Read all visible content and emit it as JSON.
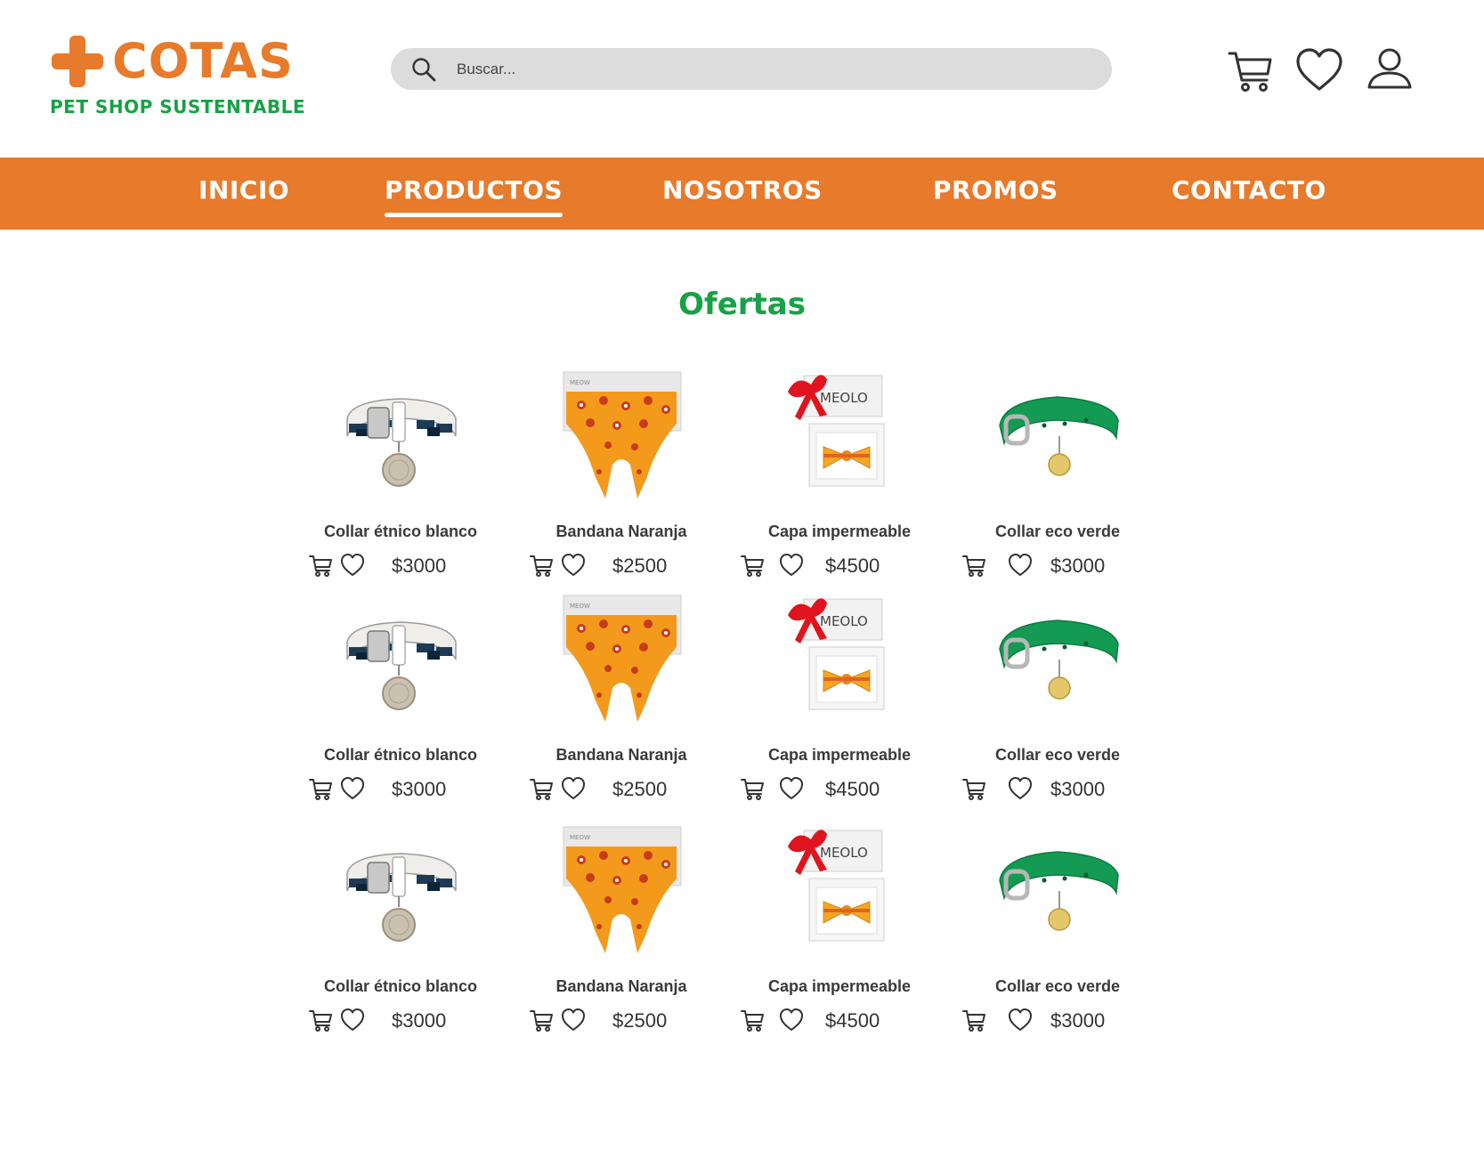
{
  "brand": {
    "name": "COTAS",
    "tagline": "PET SHOP SUSTENTABLE",
    "primary_color": "#e77a2b",
    "accent_color": "#18a146"
  },
  "search": {
    "placeholder": "Buscar...",
    "icon": "search-icon"
  },
  "header_icons": [
    "cart-icon",
    "heart-icon",
    "user-icon"
  ],
  "nav": {
    "items": [
      {
        "label": "INICIO",
        "active": false
      },
      {
        "label": "PRODUCTOS",
        "active": true
      },
      {
        "label": "NOSOTROS",
        "active": false
      },
      {
        "label": "PROMOS",
        "active": false
      },
      {
        "label": "CONTACTO",
        "active": false
      }
    ]
  },
  "section_title": "Ofertas",
  "products": [
    [
      {
        "name": "Collar étnico blanco",
        "price": "$3000",
        "image": "white-collar"
      },
      {
        "name": "Bandana Naranja",
        "price": "$2500",
        "image": "orange-bandana"
      },
      {
        "name": "Capa impermeable",
        "price": "$4500",
        "image": "gift-box"
      },
      {
        "name": "Collar eco verde",
        "price": "$3000",
        "image": "green-collar"
      }
    ],
    [
      {
        "name": "Collar étnico blanco",
        "price": "$3000",
        "image": "white-collar"
      },
      {
        "name": "Bandana Naranja",
        "price": "$2500",
        "image": "orange-bandana"
      },
      {
        "name": "Capa impermeable",
        "price": "$4500",
        "image": "gift-box"
      },
      {
        "name": "Collar eco verde",
        "price": "$3000",
        "image": "green-collar"
      }
    ],
    [
      {
        "name": "Collar étnico blanco",
        "price": "$3000",
        "image": "white-collar"
      },
      {
        "name": "Bandana Naranja",
        "price": "$2500",
        "image": "orange-bandana"
      },
      {
        "name": "Capa impermeable",
        "price": "$4500",
        "image": "gift-box"
      },
      {
        "name": "Collar eco verde",
        "price": "$3000",
        "image": "green-collar"
      }
    ]
  ]
}
